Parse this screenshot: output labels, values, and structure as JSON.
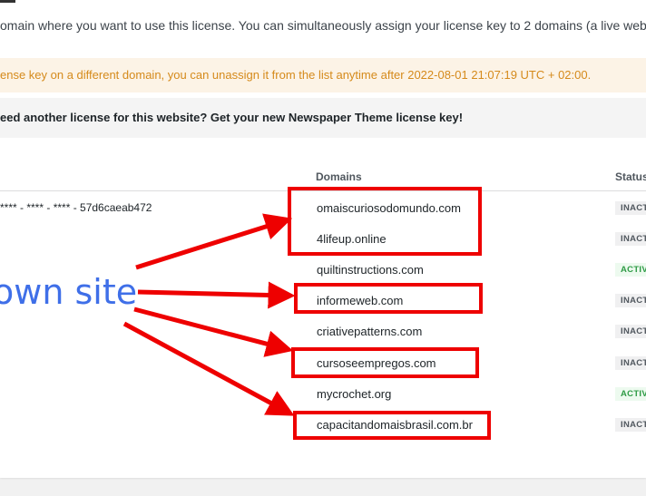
{
  "intro_text": "omain where you want to use this license. You can simultaneously assign your license key to 2 domains (a live websi",
  "notice_text": "ense key on a different domain, you can unassign it from the list anytime after 2022-08-01 21:07:19 UTC + 02:00.",
  "promo_text": "eed another license for this website? Get your new Newspaper Theme license key!",
  "table": {
    "headers": {
      "domains": "Domains",
      "status": "Status"
    },
    "license_key": "**** - **** - **** - 57d6caeab472",
    "rows": [
      {
        "domain": "omaiscuriosodomundo.com",
        "status": "INACT"
      },
      {
        "domain": "4lifeup.online",
        "status": "INACT"
      },
      {
        "domain": "quiltinstructions.com",
        "status": "ACTIV"
      },
      {
        "domain": "informeweb.com",
        "status": "INACT"
      },
      {
        "domain": "criativepatterns.com",
        "status": "INACT"
      },
      {
        "domain": "cursoseempregos.com",
        "status": "INACT"
      },
      {
        "domain": "mycrochet.org",
        "status": "ACTIV"
      },
      {
        "domain": "capacitandomaisbrasil.com.br",
        "status": "INACT"
      }
    ]
  },
  "annotation_text": "own site",
  "colors": {
    "annotation_red": "#ee0000",
    "annotation_blue": "#3f6fe8",
    "notice_bg": "#fcf3e6",
    "notice_text": "#d58a1b"
  }
}
